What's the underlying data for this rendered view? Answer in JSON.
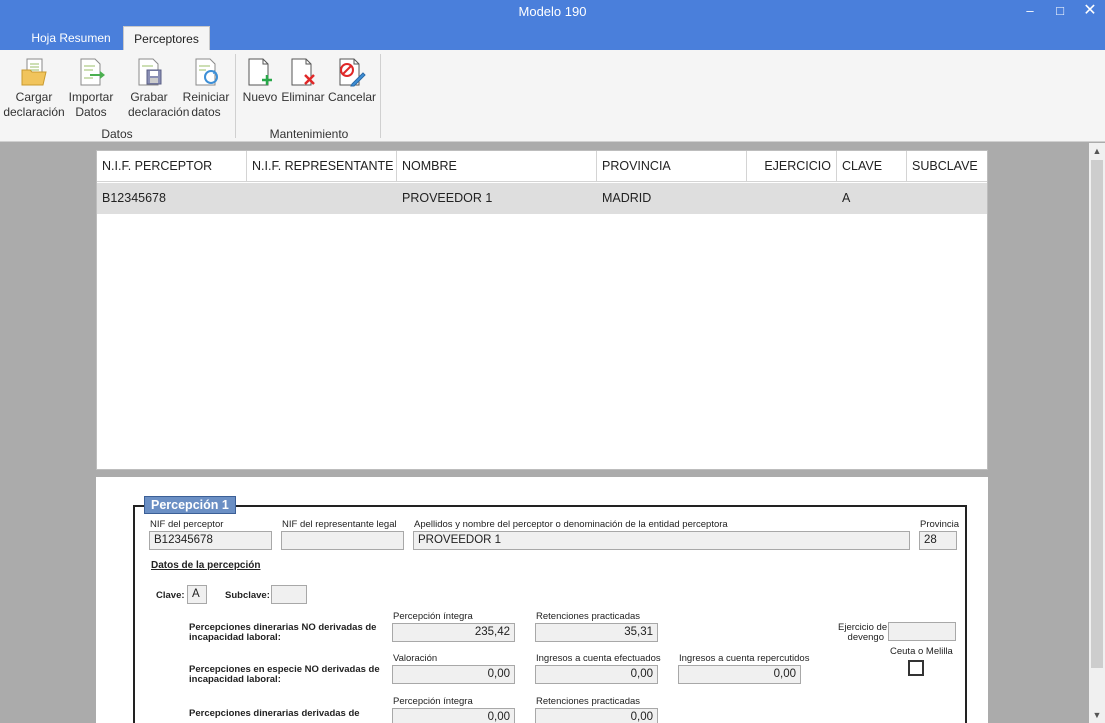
{
  "window": {
    "title": "Modelo 190",
    "minimize": "‒",
    "maximize": "□",
    "close": "✕"
  },
  "tabs": [
    {
      "label": "Hoja Resumen"
    },
    {
      "label": "Perceptores"
    }
  ],
  "ribbon": {
    "buttons": [
      {
        "line1": "Cargar",
        "line2": "declaración"
      },
      {
        "line1": "Importar",
        "line2": "Datos"
      },
      {
        "line1": "Grabar",
        "line2": "declaración"
      },
      {
        "line1": "Reiniciar",
        "line2": "datos"
      },
      {
        "line1": "Nuevo",
        "line2": ""
      },
      {
        "line1": "Eliminar",
        "line2": ""
      },
      {
        "line1": "Cancelar",
        "line2": ""
      }
    ],
    "groups": [
      {
        "label": "Datos"
      },
      {
        "label": "Mantenimiento"
      }
    ]
  },
  "grid": {
    "columns": [
      "N.I.F. PERCEPTOR",
      "N.I.F. REPRESENTANTE",
      "NOMBRE",
      "PROVINCIA",
      "EJERCICIO",
      "CLAVE",
      "SUBCLAVE"
    ],
    "rows": [
      [
        "B12345678",
        "",
        "PROVEEDOR 1",
        "MADRID",
        "",
        "A",
        ""
      ]
    ]
  },
  "form": {
    "legend": "Percepción 1",
    "nif_perceptor_label": "NIF del perceptor",
    "nif_perceptor": "B12345678",
    "nif_representante_label": "NIF del representante legal",
    "nif_representante": "",
    "nombre_label": "Apellidos y nombre del perceptor o denominación de la entidad perceptora",
    "nombre": "PROVEEDOR 1",
    "provincia_label": "Provincia",
    "provincia": "28",
    "section_title": "Datos de la percepción",
    "clave_label": "Clave:",
    "clave": "A",
    "subclave_label": "Subclave:",
    "subclave": "",
    "row1_label_a": "Percepciones dinerarias NO derivadas de",
    "row1_label_b": "incapacidad laboral:",
    "row1_col1_label": "Percepción íntegra",
    "row1_col1": "235,42",
    "row1_col2_label": "Retenciones practicadas",
    "row1_col2": "35,31",
    "ejercicio_label_a": "Ejercicio de",
    "ejercicio_label_b": "devengo",
    "ejercicio": "",
    "ceuta_label": "Ceuta o Melilla",
    "row2_label_a": "Percepciones en especie NO derivadas de",
    "row2_label_b": "incapacidad laboral:",
    "row2_col1_label": "Valoración",
    "row2_col1": "0,00",
    "row2_col2_label": "Ingresos a cuenta efectuados",
    "row2_col2": "0,00",
    "row2_col3_label": "Ingresos a cuenta repercutidos",
    "row2_col3": "0,00",
    "row3_label_a": "Percepciones dinerarias derivadas de",
    "row3_col1_label": "Percepción íntegra",
    "row3_col1": "0,00",
    "row3_col2_label": "Retenciones practicadas",
    "row3_col2": "0,00"
  }
}
